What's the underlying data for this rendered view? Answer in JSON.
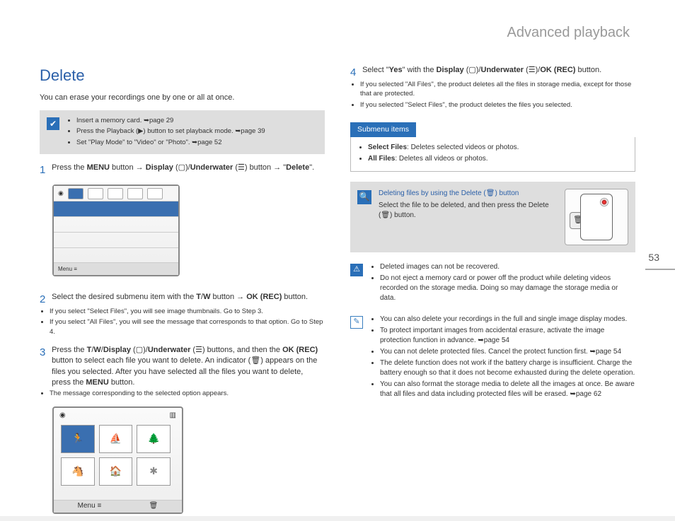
{
  "chapterTitle": "Advanced playback",
  "pageNumber": "53",
  "left": {
    "heading": "Delete",
    "intro": "You can erase your recordings one by one or all at once.",
    "topNote": {
      "items": [
        "Insert a memory card. ➥page 29",
        "Press the Playback (▶) button to set playback mode. ➥page 39",
        "Set \"Play Mode\" to \"Video\" or \"Photo\". ➥page 52"
      ]
    },
    "step1": {
      "num": "1",
      "pre": "Press the ",
      "b1": "MENU",
      "mid1": " button → ",
      "b2": "Display",
      "mid2": " (▢)/",
      "b3": "Underwater",
      "mid3": " (☰) button → \"",
      "b4": "Delete",
      "end": "\"."
    },
    "step2": {
      "num": "2",
      "pre": "Select the desired submenu item with the ",
      "b1": "T",
      "slash": "/",
      "b2": "W",
      "mid": " button → ",
      "b3": "OK (REC)",
      "end": " button.",
      "bullets": [
        "If you select \"Select Files\", you will see image thumbnails. Go to Step 3.",
        "If you select \"All Files\", you will see the message that corresponds to that option. Go to Step 4."
      ]
    },
    "step3": {
      "num": "3",
      "pre": "Press the ",
      "b1": "T",
      "s1": "/",
      "b2": "W",
      "s2": "/",
      "b3": "Display",
      "mid1": " (▢)/",
      "b4": "Underwater",
      "mid2": " (☰) buttons, and then the ",
      "b5": "OK (REC)",
      "mid3": " button to select each file you want to delete. An indicator (🗑) appears on the files you selected. After you have selected all the files you want to delete, press the ",
      "b6": "MENU",
      "end": " button.",
      "bullets": [
        "The message corresponding to the selected option appears."
      ]
    }
  },
  "right": {
    "step4": {
      "num": "4",
      "pre": "Select \"",
      "b1": "Yes",
      "mid1": "\" with the ",
      "b2": "Display",
      "mid2": " (▢)/",
      "b3": "Underwater",
      "mid3": " (☰)/",
      "b4": "OK (REC)",
      "end": " button.",
      "bullets": [
        "If you selected \"All Files\", the product deletes all the files in storage media, except for those that are protected.",
        "If you selected \"Select Files\", the product deletes the files you selected."
      ]
    },
    "submenu": {
      "title": "Submenu items",
      "items": [
        {
          "b": "Select Files",
          "rest": ": Deletes selected videos or photos."
        },
        {
          "b": "All Files",
          "rest": ": Deletes all videos or photos."
        }
      ]
    },
    "tip": {
      "title": "Deleting files by using the Delete (🗑) button",
      "body": "Select the file to be deleted, and then press the Delete (🗑) button."
    },
    "warn": {
      "bullets": [
        "Deleted images can not be recovered.",
        "Do not eject a memory card or power off the product while deleting videos recorded on the storage media. Doing so may damage the storage media or data."
      ]
    },
    "info": {
      "bullets": [
        "You can also delete your recordings in the full and single image display modes.",
        "To protect important images from accidental erasure, activate the image protection function in advance. ➥page 54",
        "You can not delete protected files. Cancel the protect function first. ➥page 54",
        "The delete function does not work if the battery charge is insufficient. Charge the battery enough so that it does not become exhausted during the delete operation.",
        "You can also format the storage media to delete all the images at once. Be aware that all files and data including protected files will be erased. ➥page 62"
      ]
    }
  }
}
